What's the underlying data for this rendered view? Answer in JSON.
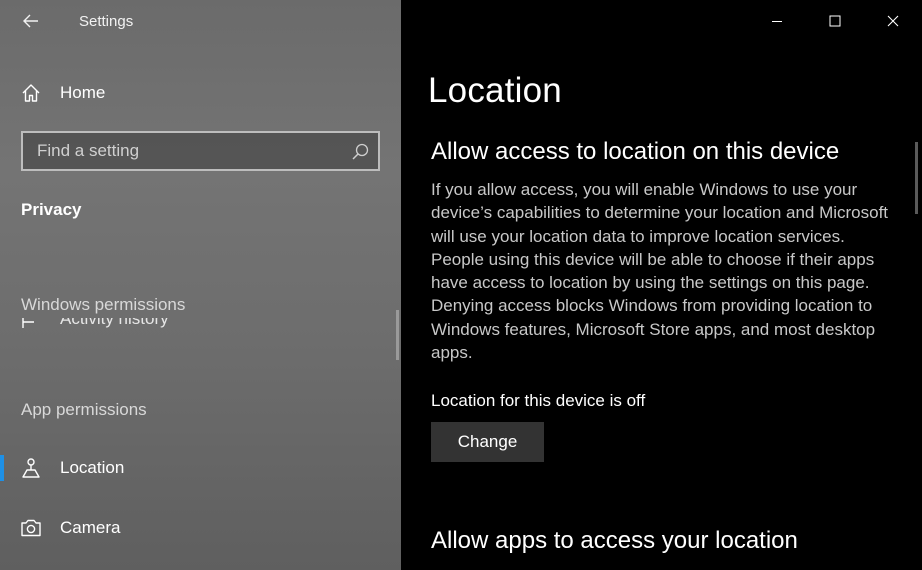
{
  "window": {
    "title": "Settings"
  },
  "sidebar": {
    "home_label": "Home",
    "search": {
      "placeholder": "Find a setting"
    },
    "section_title": "Privacy",
    "group_windows_permissions": "Windows permissions",
    "partial_item_label": "Activity history",
    "group_app_permissions": "App permissions",
    "items": [
      {
        "label": "Location",
        "icon": "location-person-icon",
        "active": true
      },
      {
        "label": "Camera",
        "icon": "camera-icon",
        "active": false
      }
    ]
  },
  "main": {
    "page_title": "Location",
    "section1_title": "Allow access to location on this device",
    "section1_desc": "If you allow access, you will enable Windows to use your device’s capabilities to determine your location and Microsoft will use your location data to improve location services. People using this device will be able to choose if their apps have access to location by using the settings on this page. Denying access blocks Windows from providing location to Windows features, Microsoft Store apps, and most desktop apps.",
    "device_status": "Location for this device is off",
    "change_button": "Change",
    "section2_title": "Allow apps to access your location"
  },
  "colors": {
    "accent": "#1e90e6",
    "main_bg": "#000000",
    "button_bg": "#333333"
  }
}
